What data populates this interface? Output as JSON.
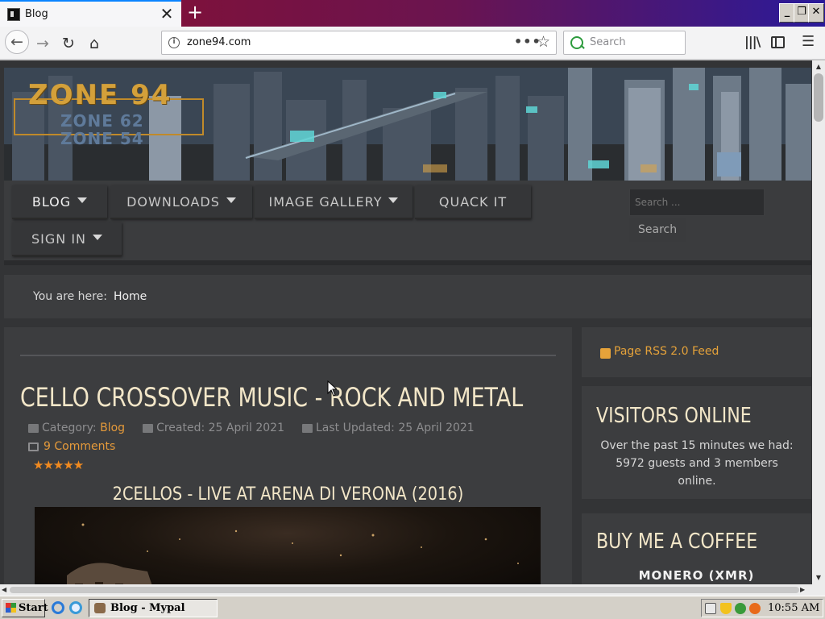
{
  "browser": {
    "tab_title": "Blog",
    "tab_close": "✕",
    "new_tab": "+",
    "url": "zone94.com",
    "page_actions": "•••",
    "bookmark_star": "☆",
    "search_placeholder": "Search",
    "window_buttons": {
      "minimize": "_",
      "maximize": "❐",
      "close": "✕"
    },
    "icons": {
      "back": "←",
      "forward": "→",
      "reload": "↻",
      "home": "⌂",
      "info": "i",
      "library": "|||\\",
      "menu": "☰"
    }
  },
  "site": {
    "logo": {
      "main": "ZONE 94",
      "sub1": "ZONE 62",
      "sub2": "ZONE 54"
    },
    "menu": [
      {
        "label": "BLOG",
        "has_caret": true,
        "active": true
      },
      {
        "label": "DOWNLOADS",
        "has_caret": true
      },
      {
        "label": "IMAGE GALLERY",
        "has_caret": true
      },
      {
        "label": "QUACK IT",
        "has_caret": false
      },
      {
        "label": "SIGN IN",
        "has_caret": true
      }
    ],
    "search": {
      "placeholder": "Search ...",
      "button": "Search"
    },
    "breadcrumb": {
      "prefix": "You are here:",
      "current": "Home"
    }
  },
  "article": {
    "title": "CELLO CROSSOVER MUSIC - ROCK AND METAL",
    "category_label": "Category:",
    "category": "Blog",
    "created": "Created: 25 April 2021",
    "updated": "Last Updated: 25 April 2021",
    "comments": "9 Comments",
    "rating": "★★★★★",
    "rating_value": 5,
    "video_title": "2CELLOS - LIVE AT ARENA DI VERONA (2016)"
  },
  "sidebar": {
    "rss": "Page RSS 2.0 Feed",
    "visitors_title": "VISITORS ONLINE",
    "visitors_text": "Over the past 15 minutes we had: 5972 guests and 3 members online.",
    "coffee_title": "BUY ME A COFFEE",
    "monero": "MONERO (XMR)"
  },
  "taskbar": {
    "start": "Start",
    "app": "Blog - Mypal",
    "clock": "10:55 AM"
  },
  "colors": {
    "accent_orange": "#e59a3a",
    "title_cream": "#f2e6c8",
    "panel": "#3c3d3f",
    "page_bg": "#333436"
  }
}
